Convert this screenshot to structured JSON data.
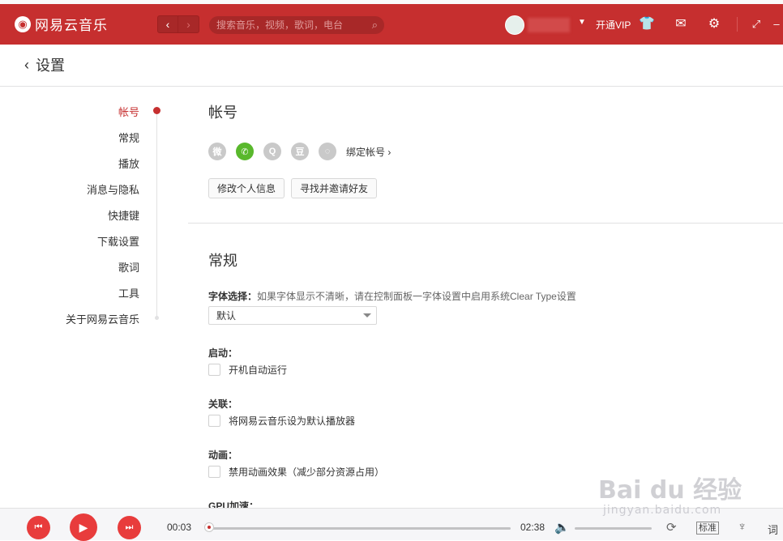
{
  "header": {
    "logo_mark": "◉",
    "app_name": "网易云音乐",
    "back_icon": "‹",
    "forward_icon": "›",
    "search_placeholder": "搜索音乐，视频，歌词，电台",
    "username": "",
    "vip_label": "开通VIP",
    "icons": [
      "skin-icon",
      "mail-icon",
      "settings-icon",
      "mini-mode-icon"
    ]
  },
  "page": {
    "back_chevron": "‹",
    "title": "设置"
  },
  "sidenav": {
    "items": [
      {
        "label": "帐号",
        "active": true
      },
      {
        "label": "常规"
      },
      {
        "label": "播放"
      },
      {
        "label": "消息与隐私"
      },
      {
        "label": "快捷键"
      },
      {
        "label": "下载设置"
      },
      {
        "label": "歌词"
      },
      {
        "label": "工具"
      },
      {
        "label": "关于网易云音乐"
      }
    ]
  },
  "account": {
    "title": "帐号",
    "social_icons": [
      {
        "name": "weibo-icon",
        "glyph": "微"
      },
      {
        "name": "wechat-icon",
        "glyph": "✆"
      },
      {
        "name": "qq-icon",
        "glyph": "Q"
      },
      {
        "name": "douban-icon",
        "glyph": "豆"
      },
      {
        "name": "yixin-icon",
        "glyph": "◌"
      }
    ],
    "bind_label": "绑定帐号 ›",
    "edit_profile_button": "修改个人信息",
    "invite_button": "寻找并邀请好友"
  },
  "general": {
    "title": "常规",
    "font_label": "字体选择：",
    "font_hint": "如果字体显示不清晰，请在控制面板一字体设置中启用系统Clear Type设置",
    "font_value": "默认",
    "startup_label": "启动：",
    "startup_option": "开机自动运行",
    "assoc_label": "关联：",
    "assoc_option": "将网易云音乐设为默认播放器",
    "anim_label": "动画：",
    "anim_option": "禁用动画效果（减少部分资源占用）",
    "gpu_label": "GPU加速："
  },
  "player": {
    "prev_icon": "⏮",
    "play_icon": "▶",
    "next_icon": "⏭",
    "current_time": "00:03",
    "total_time": "02:38",
    "progress": 0.02,
    "volume": 0.0,
    "quality_label": "标准",
    "lyrics_label": "词"
  },
  "watermark": {
    "text": "Bai du 经验",
    "url": "jingyan.baidu.com"
  },
  "colors": {
    "brand_red": "#c62f2f",
    "player_red": "#e83c3c",
    "wechat_green": "#59b82c"
  }
}
